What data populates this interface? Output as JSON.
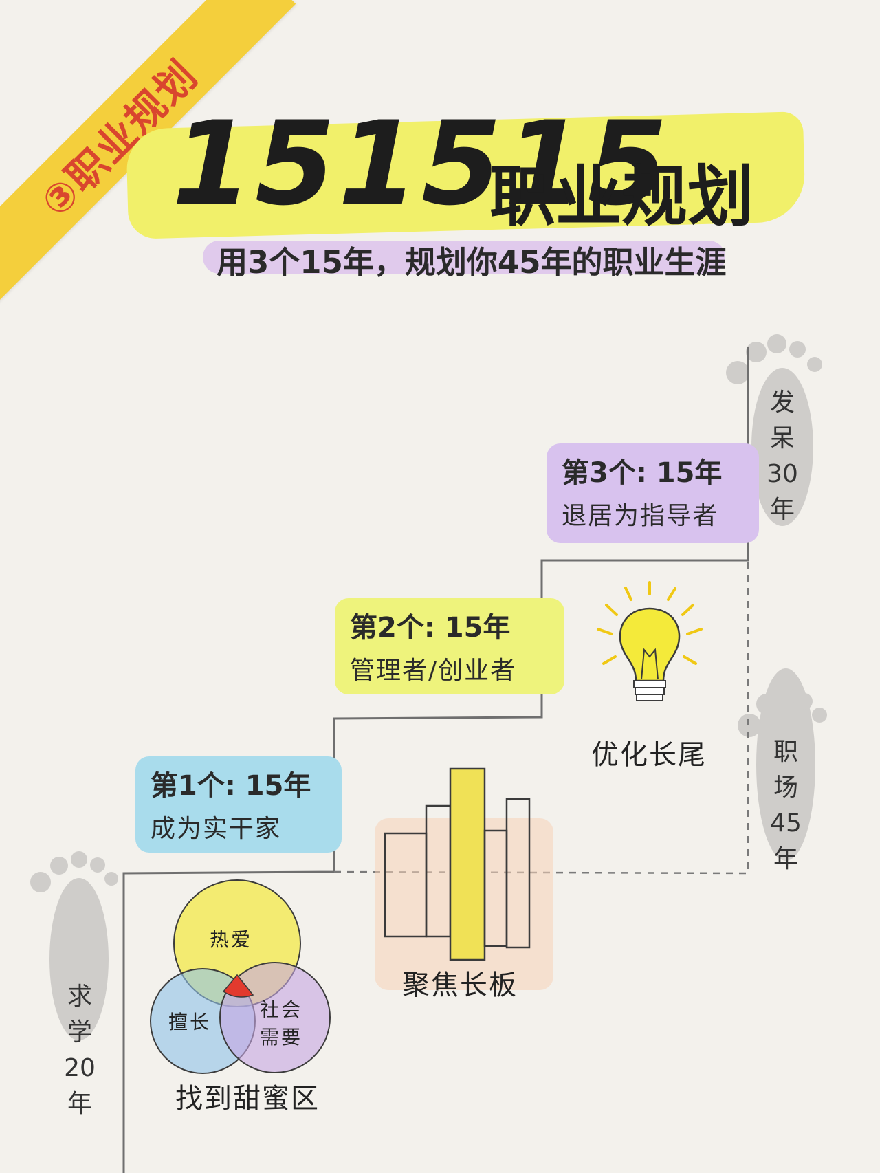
{
  "badge": {
    "label": "③职业规划"
  },
  "title": {
    "number": "151515",
    "text": "职业规划"
  },
  "subtitle": "用3个15年，规划你45年的职业生涯",
  "stages": [
    {
      "title": "第1个: 15年",
      "desc": "成为实干家",
      "color": "#a9dcec"
    },
    {
      "title": "第2个: 15年",
      "desc": "管理者/创业者",
      "color": "#eef37c"
    },
    {
      "title": "第3个: 15年",
      "desc": "退居为指导者",
      "color": "#d8c2ee"
    }
  ],
  "phases": {
    "study": [
      "求",
      "学",
      "20",
      "年"
    ],
    "work": [
      "职",
      "场",
      "45",
      "年"
    ],
    "idle": [
      "发",
      "呆",
      "30",
      "年"
    ]
  },
  "captions": {
    "sweet_zone": "找到甜蜜区",
    "focus": "聚焦长板",
    "optimize": "优化长尾"
  },
  "venn": {
    "passion": "热爱",
    "skill": "擅长",
    "social_need_1": "社会",
    "social_need_2": "需要"
  },
  "colors": {
    "ribbon": "#f4cf3c",
    "ribbon_text": "#d9462e",
    "title_highlight": "#f1f06a",
    "subtitle_highlight": "#dcc3ec",
    "venn_yellow": "#f2ea5c",
    "venn_blue": "#8fc3ea",
    "venn_purple": "#c7a6e2",
    "venn_center": "#e23a2e"
  }
}
